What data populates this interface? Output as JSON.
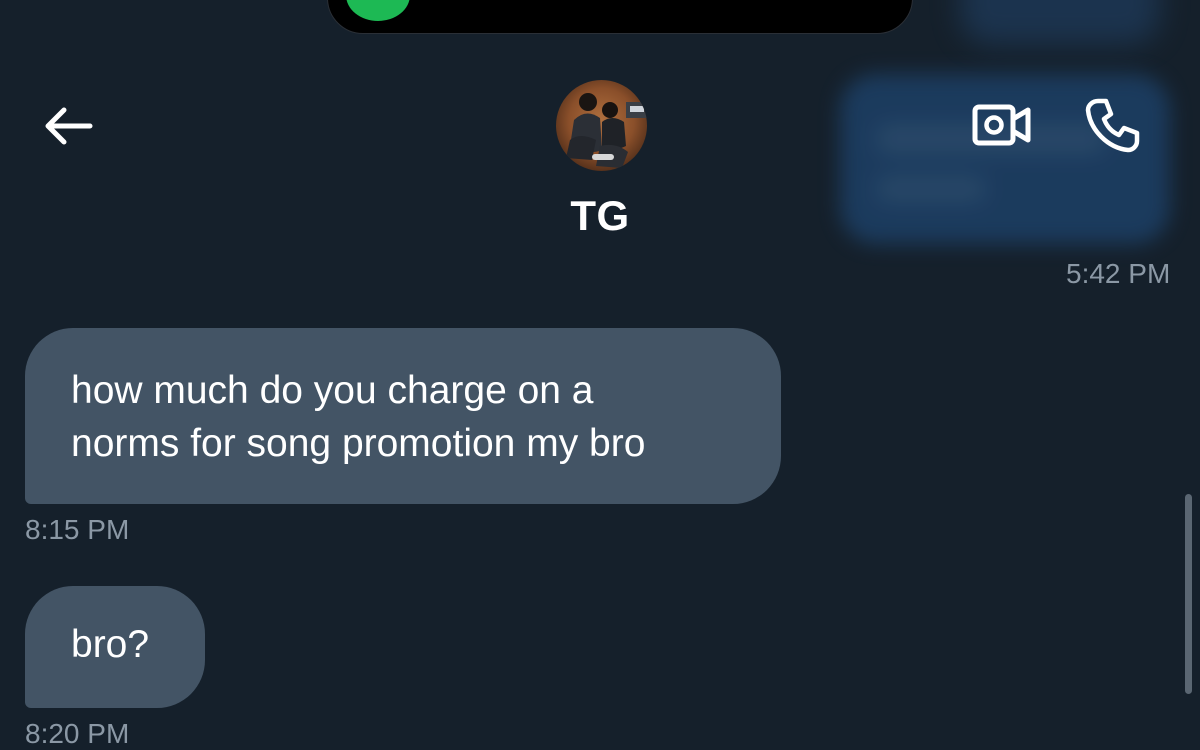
{
  "header": {
    "contact_name": "TG",
    "back_icon": "arrow-left-icon",
    "video_icon": "video-camera-icon",
    "phone_icon": "phone-icon"
  },
  "messages": [
    {
      "lines": [
        "how much do you charge on a",
        "norms for song promotion my bro"
      ],
      "timestamp": "8:15 PM"
    },
    {
      "lines": [
        "bro?"
      ],
      "timestamp": "8:20 PM"
    }
  ],
  "previous_timestamp": "5:42 PM",
  "colors": {
    "background": "#15202b",
    "bubble": "#435465",
    "timestamp": "#8b98a5",
    "accent_green": "#1db954"
  }
}
